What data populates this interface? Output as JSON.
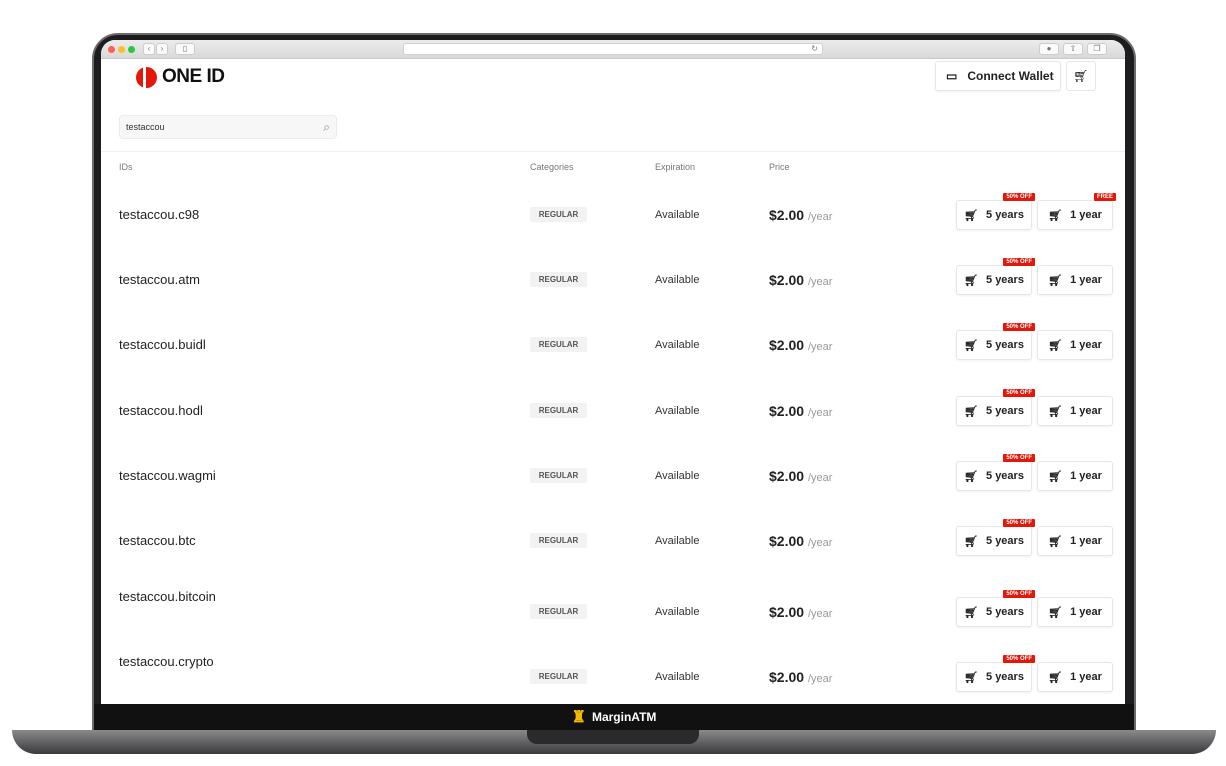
{
  "brand": {
    "name": "ONE ID",
    "accent": "#e3170a"
  },
  "header": {
    "connect_wallet": "Connect Wallet"
  },
  "search": {
    "value": "testaccou"
  },
  "columns": {
    "ids": "IDs",
    "categories": "Categories",
    "expiration": "Expiration",
    "price": "Price"
  },
  "rows": [
    {
      "id": "testaccou.c98",
      "category": "REGULAR",
      "expiration": "Available",
      "price": "$2.00",
      "unit": "/year",
      "buy5": "5 years",
      "buy5_tag": "50% OFF",
      "buy1": "1 year",
      "buy1_tag": "FREE"
    },
    {
      "id": "testaccou.atm",
      "category": "REGULAR",
      "expiration": "Available",
      "price": "$2.00",
      "unit": "/year",
      "buy5": "5 years",
      "buy5_tag": "50% OFF",
      "buy1": "1 year"
    },
    {
      "id": "testaccou.buidl",
      "category": "REGULAR",
      "expiration": "Available",
      "price": "$2.00",
      "unit": "/year",
      "buy5": "5 years",
      "buy5_tag": "50% OFF",
      "buy1": "1 year"
    },
    {
      "id": "testaccou.hodl",
      "category": "REGULAR",
      "expiration": "Available",
      "price": "$2.00",
      "unit": "/year",
      "buy5": "5 years",
      "buy5_tag": "50% OFF",
      "buy1": "1 year"
    },
    {
      "id": "testaccou.wagmi",
      "category": "REGULAR",
      "expiration": "Available",
      "price": "$2.00",
      "unit": "/year",
      "buy5": "5 years",
      "buy5_tag": "50% OFF",
      "buy1": "1 year"
    },
    {
      "id": "testaccou.btc",
      "category": "REGULAR",
      "expiration": "Available",
      "price": "$2.00",
      "unit": "/year",
      "buy5": "5 years",
      "buy5_tag": "50% OFF",
      "buy1": "1 year"
    },
    {
      "id": "testaccou.bitcoin",
      "category": "REGULAR",
      "expiration": "Available",
      "price": "$2.00",
      "unit": "/year",
      "buy5": "5 years",
      "buy5_tag": "50% OFF",
      "buy1": "1 year"
    },
    {
      "id": "testaccou.crypto",
      "category": "REGULAR",
      "expiration": "Available",
      "price": "$2.00",
      "unit": "/year",
      "buy5": "5 years",
      "buy5_tag": "50% OFF",
      "buy1": "1 year"
    }
  ],
  "footer": {
    "brand": "MarginATM",
    "icon_color": "#f5b800"
  }
}
